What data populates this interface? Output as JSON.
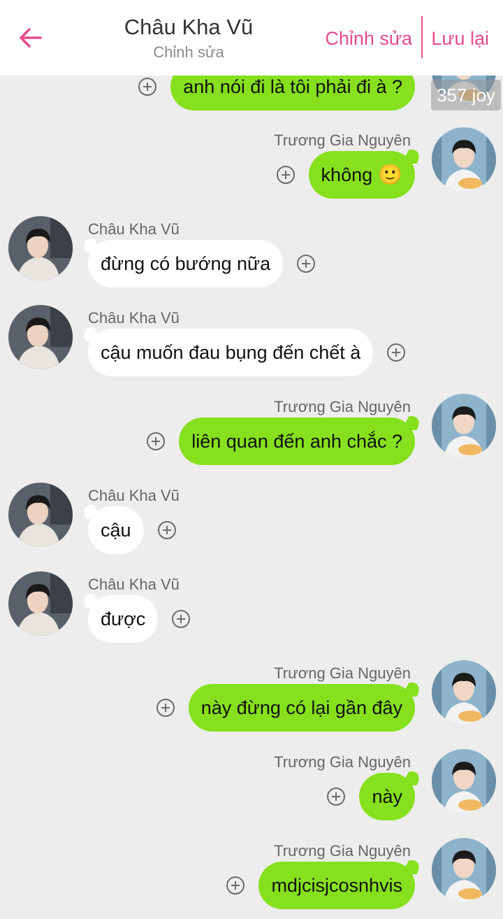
{
  "header": {
    "title": "Châu Kha Vũ",
    "subtitle": "Chỉnh sửa",
    "edit_label": "Chỉnh sửa",
    "save_label": "Lưu lại",
    "accent_color": "#e64b8c"
  },
  "watermark": "357 joy",
  "colors": {
    "background": "#ededed",
    "outgoing_bubble": "#86e01e",
    "incoming_bubble": "#ffffff"
  },
  "messages": [
    {
      "side": "right",
      "sender": "",
      "text": "anh nói đi là tôi phải đi à ?",
      "emoji": ""
    },
    {
      "side": "right",
      "sender": "Trương Gia Nguyên",
      "text": "không",
      "emoji": "🙂"
    },
    {
      "side": "left",
      "sender": "Châu Kha Vũ",
      "text": "đừng có bướng nữa",
      "emoji": ""
    },
    {
      "side": "left",
      "sender": "Châu Kha Vũ",
      "text": "cậu muốn đau bụng đến chết à",
      "emoji": ""
    },
    {
      "side": "right",
      "sender": "Trương Gia Nguyên",
      "text": "liên quan đến anh chắc ?",
      "emoji": ""
    },
    {
      "side": "left",
      "sender": "Châu Kha Vũ",
      "text": "cậu",
      "emoji": ""
    },
    {
      "side": "left",
      "sender": "Châu Kha Vũ",
      "text": "được",
      "emoji": ""
    },
    {
      "side": "right",
      "sender": "Trương Gia Nguyên",
      "text": "này đừng có lại gần đây",
      "emoji": ""
    },
    {
      "side": "right",
      "sender": "Trương Gia Nguyên",
      "text": "này",
      "emoji": ""
    },
    {
      "side": "right",
      "sender": "Trương Gia Nguyên",
      "text": "mdjcisjcosnhvis",
      "emoji": ""
    }
  ]
}
